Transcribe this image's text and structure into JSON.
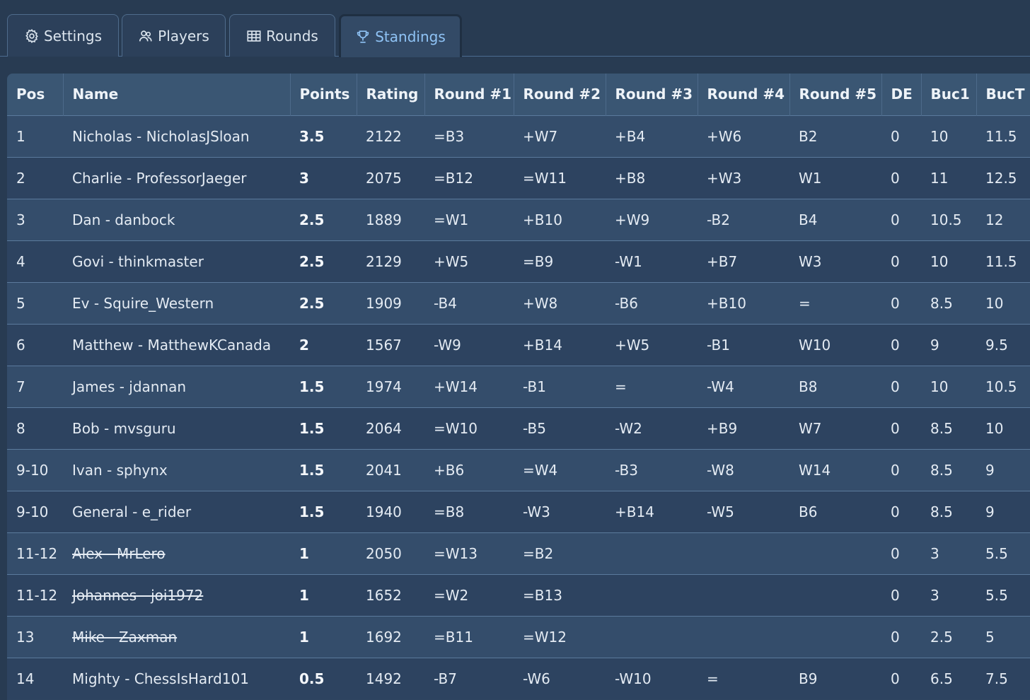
{
  "tabs": [
    {
      "label": "Settings",
      "icon": "gear-icon"
    },
    {
      "label": "Players",
      "icon": "players-icon"
    },
    {
      "label": "Rounds",
      "icon": "grid-icon"
    },
    {
      "label": "Standings",
      "icon": "trophy-icon",
      "active": true
    }
  ],
  "colors": {
    "accent": "#8fc3f5",
    "background": "#283b52"
  },
  "table": {
    "headers": [
      "Pos",
      "Name",
      "Points",
      "Rating",
      "Round #1",
      "Round #2",
      "Round #3",
      "Round #4",
      "Round #5",
      "DE",
      "Buc1",
      "BucT"
    ],
    "rows": [
      {
        "pos": "1",
        "name": "Nicholas - NicholasJSloan",
        "withdrawn": false,
        "points": "3.5",
        "rating": "2122",
        "r1": "=B3",
        "r2": "+W7",
        "r3": "+B4",
        "r4": "+W6",
        "r5": "B2",
        "de": "0",
        "buc1": "10",
        "buct": "11.5"
      },
      {
        "pos": "2",
        "name": "Charlie - ProfessorJaeger",
        "withdrawn": false,
        "points": "3",
        "rating": "2075",
        "r1": "=B12",
        "r2": "=W11",
        "r3": "+B8",
        "r4": "+W3",
        "r5": "W1",
        "de": "0",
        "buc1": "11",
        "buct": "12.5"
      },
      {
        "pos": "3",
        "name": "Dan - danbock",
        "withdrawn": false,
        "points": "2.5",
        "rating": "1889",
        "r1": "=W1",
        "r2": "+B10",
        "r3": "+W9",
        "r4": "-B2",
        "r5": "B4",
        "de": "0",
        "buc1": "10.5",
        "buct": "12"
      },
      {
        "pos": "4",
        "name": "Govi - thinkmaster",
        "withdrawn": false,
        "points": "2.5",
        "rating": "2129",
        "r1": "+W5",
        "r2": "=B9",
        "r3": "-W1",
        "r4": "+B7",
        "r5": "W3",
        "de": "0",
        "buc1": "10",
        "buct": "11.5"
      },
      {
        "pos": "5",
        "name": "Ev - Squire_Western",
        "withdrawn": false,
        "points": "2.5",
        "rating": "1909",
        "r1": "-B4",
        "r2": "+W8",
        "r3": "-B6",
        "r4": "+B10",
        "r5": "=",
        "de": "0",
        "buc1": "8.5",
        "buct": "10"
      },
      {
        "pos": "6",
        "name": "Matthew - MatthewKCanada",
        "withdrawn": false,
        "points": "2",
        "rating": "1567",
        "r1": "-W9",
        "r2": "+B14",
        "r3": "+W5",
        "r4": "-B1",
        "r5": "W10",
        "de": "0",
        "buc1": "9",
        "buct": "9.5"
      },
      {
        "pos": "7",
        "name": "James - jdannan",
        "withdrawn": false,
        "points": "1.5",
        "rating": "1974",
        "r1": "+W14",
        "r2": "-B1",
        "r3": "=",
        "r4": "-W4",
        "r5": "B8",
        "de": "0",
        "buc1": "10",
        "buct": "10.5"
      },
      {
        "pos": "8",
        "name": "Bob - mvsguru",
        "withdrawn": false,
        "points": "1.5",
        "rating": "2064",
        "r1": "=W10",
        "r2": "-B5",
        "r3": "-W2",
        "r4": "+B9",
        "r5": "W7",
        "de": "0",
        "buc1": "8.5",
        "buct": "10"
      },
      {
        "pos": "9-10",
        "name": "Ivan - sphynx",
        "withdrawn": false,
        "points": "1.5",
        "rating": "2041",
        "r1": "+B6",
        "r2": "=W4",
        "r3": "-B3",
        "r4": "-W8",
        "r5": "W14",
        "de": "0",
        "buc1": "8.5",
        "buct": "9"
      },
      {
        "pos": "9-10",
        "name": "General - e_rider",
        "withdrawn": false,
        "points": "1.5",
        "rating": "1940",
        "r1": "=B8",
        "r2": "-W3",
        "r3": "+B14",
        "r4": "-W5",
        "r5": "B6",
        "de": "0",
        "buc1": "8.5",
        "buct": "9"
      },
      {
        "pos": "11-12",
        "name": "Alex - MrLero",
        "withdrawn": true,
        "points": "1",
        "rating": "2050",
        "r1": "=W13",
        "r2": "=B2",
        "r3": "",
        "r4": "",
        "r5": "",
        "de": "0",
        "buc1": "3",
        "buct": "5.5"
      },
      {
        "pos": "11-12",
        "name": "Johannes - joi1972",
        "withdrawn": true,
        "points": "1",
        "rating": "1652",
        "r1": "=W2",
        "r2": "=B13",
        "r3": "",
        "r4": "",
        "r5": "",
        "de": "0",
        "buc1": "3",
        "buct": "5.5"
      },
      {
        "pos": "13",
        "name": "Mike - Zaxman",
        "withdrawn": true,
        "points": "1",
        "rating": "1692",
        "r1": "=B11",
        "r2": "=W12",
        "r3": "",
        "r4": "",
        "r5": "",
        "de": "0",
        "buc1": "2.5",
        "buct": "5"
      },
      {
        "pos": "14",
        "name": "Mighty - ChessIsHard101",
        "withdrawn": false,
        "points": "0.5",
        "rating": "1492",
        "r1": "-B7",
        "r2": "-W6",
        "r3": "-W10",
        "r4": "=",
        "r5": "B9",
        "de": "0",
        "buc1": "6.5",
        "buct": "7.5"
      }
    ]
  }
}
